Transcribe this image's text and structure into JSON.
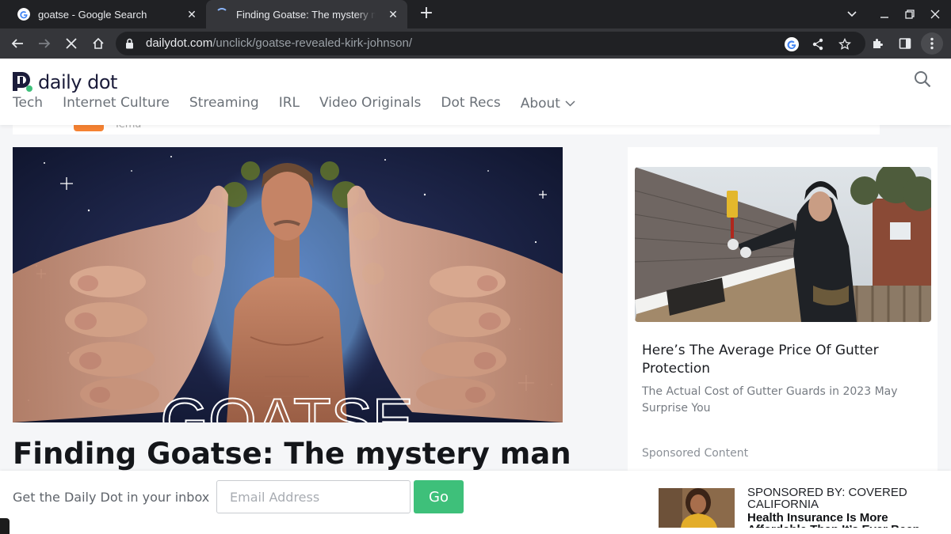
{
  "browser": {
    "tabs": [
      {
        "title": "goatse - Google Search",
        "active": false,
        "loading": false
      },
      {
        "title": "Finding Goatse: The mystery man behind the internet's most infamous image",
        "active": true,
        "loading": true
      }
    ],
    "url_host": "dailydot.com",
    "url_path": "/unclick/goatse-revealed-kirk-johnson/",
    "icons": {
      "back": "back-arrow-icon",
      "forward": "forward-arrow-icon",
      "stop": "stop-loading-icon",
      "home": "home-icon",
      "lock": "lock-icon",
      "google": "google-lens-icon",
      "share": "share-icon",
      "bookmark": "star-bookmark-icon",
      "extensions": "puzzle-extensions-icon",
      "sidepanel": "side-panel-icon",
      "menu": "kebab-menu-icon"
    }
  },
  "site": {
    "logo_text": "daily dot",
    "nav": [
      "Tech",
      "Internet Culture",
      "Streaming",
      "IRL",
      "Video Originals",
      "Dot Recs",
      "About"
    ],
    "strip_cut_text": "Tema",
    "accent_color": "#f58232"
  },
  "article": {
    "image_text": "GOATSE",
    "headline": "Finding Goatse: The mystery man"
  },
  "sidebar": {
    "title": "Here’s The Average Price Of Gutter Protection",
    "subtitle": "The Actual Cost of Gutter Guards in 2023 May Surprise You",
    "sponsored": "Sponsored Content"
  },
  "footer": {
    "newsletter_text": "Get the Daily Dot in your inbox",
    "email_placeholder": "Email Address",
    "go_label": "Go",
    "go_color": "#3ec07a",
    "ad_label": "SPONSORED BY: COVERED CALIFORNIA",
    "ad_headline": "Health Insurance Is More Affordable Than It’s Ever Been"
  }
}
